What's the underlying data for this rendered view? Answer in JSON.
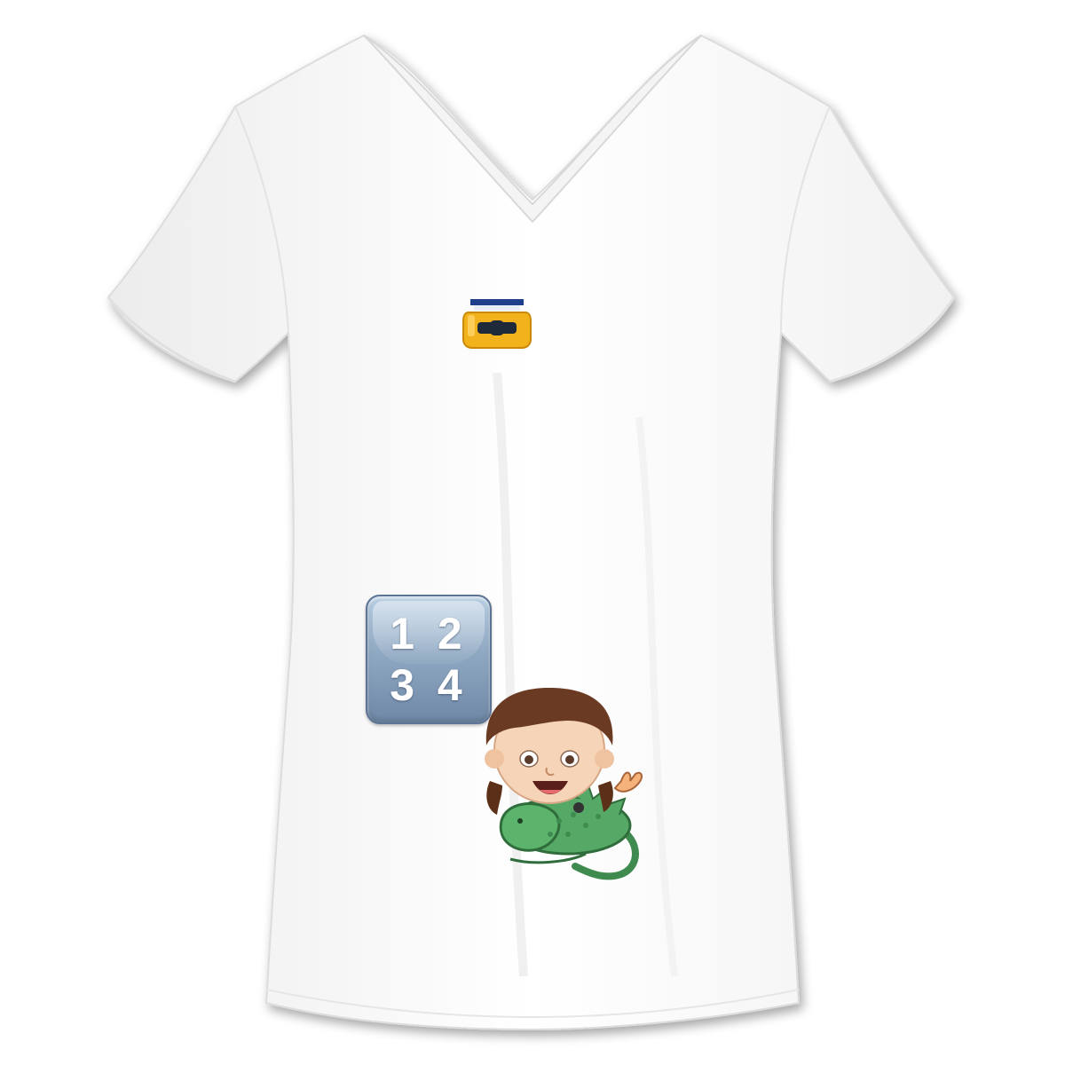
{
  "scene": {
    "subject": "white-v-neck-tshirt",
    "shirt_color": "#ffffff",
    "print": {
      "items": [
        {
          "name": "jar-emoji",
          "icon": "honey-jar-icon"
        },
        {
          "name": "numbers-emoji",
          "icon": "input-numbers-icon",
          "row_top": "1 2",
          "row_bottom": "3 4",
          "tile_color": "#8fa8c2"
        },
        {
          "name": "girl-on-dragon-emoji",
          "icon": "girl-dragon-icon",
          "hair_color": "#6b3a22",
          "dragon_color": "#4f9d5d"
        }
      ]
    }
  }
}
